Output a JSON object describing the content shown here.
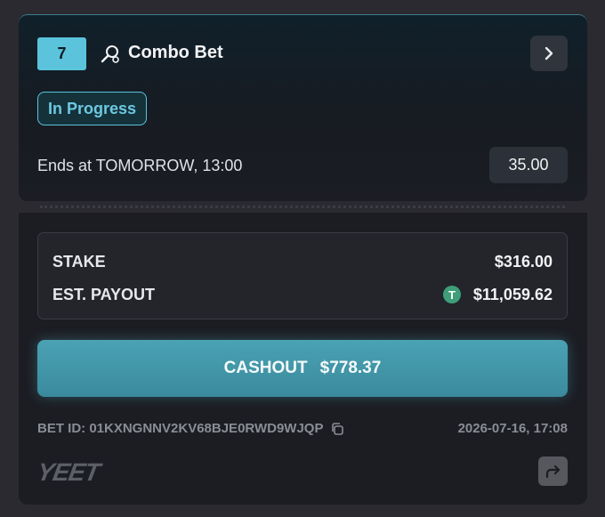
{
  "bet": {
    "number": "7",
    "title": "Combo Bet",
    "status": "In Progress",
    "ends_text": "Ends at TOMORROW, 13:00",
    "odds": "35.00"
  },
  "summary": {
    "stake_label": "STAKE",
    "stake_value": "$316.00",
    "payout_label": "EST. PAYOUT",
    "payout_value": "$11,059.62",
    "payout_currency_icon": "tether-icon",
    "tether_symbol": "T"
  },
  "cashout": {
    "label": "CASHOUT",
    "amount": "$778.37"
  },
  "footer": {
    "bet_id": "BET ID: 01KXNGNNV2KV68BJE0RWD9WJQP",
    "date": "2026-07-16, 17:08",
    "logo": "YEET"
  },
  "colors": {
    "accent": "#5bc3dc",
    "cashout": "#4296a8",
    "tether": "#3e9e7a"
  }
}
